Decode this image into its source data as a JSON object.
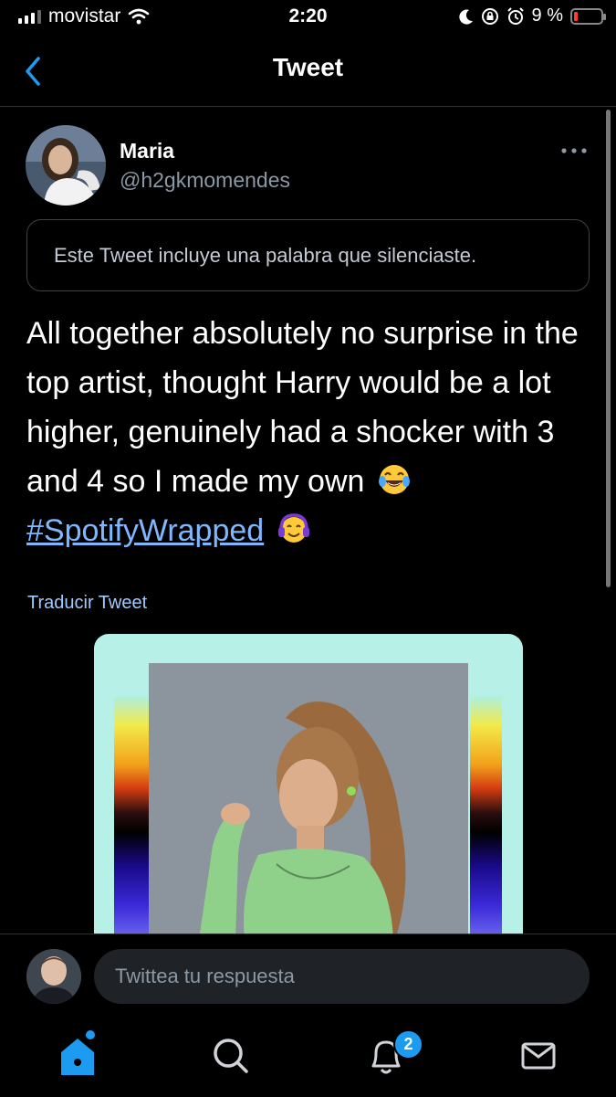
{
  "status_bar": {
    "carrier": "movistar",
    "time": "2:20",
    "battery_percent": "9 %",
    "icons": [
      "signal-icon",
      "wifi-icon",
      "moon-icon",
      "orientation-lock-icon",
      "alarm-icon",
      "battery-icon"
    ]
  },
  "nav": {
    "title": "Tweet",
    "back_icon": "chevron-left-icon"
  },
  "tweet": {
    "author_name": "Maria",
    "author_handle": "@h2gkmomendes",
    "muted_notice": "Este Tweet incluye una palabra que silenciaste.",
    "text": "All together absolutely no surprise in the top artist, thought Harry would be a lot higher, genuinely had a shocker with 3 and 4 so I made my own",
    "hashtag": "#SpotifyWrapped",
    "translate_label": "Traducir Tweet",
    "emojis": [
      "tears-of-joy-emoji",
      "headphones-face-emoji"
    ]
  },
  "reply": {
    "placeholder": "Twittea tu respuesta"
  },
  "tab_bar": {
    "items": [
      "home-icon",
      "search-icon",
      "notifications-icon",
      "messages-icon"
    ],
    "notifications_badge": "2"
  },
  "colors": {
    "background": "#000000",
    "link": "#7fb7ff",
    "accent": "#1d9bf0",
    "card_background": "#b6f0e6"
  }
}
